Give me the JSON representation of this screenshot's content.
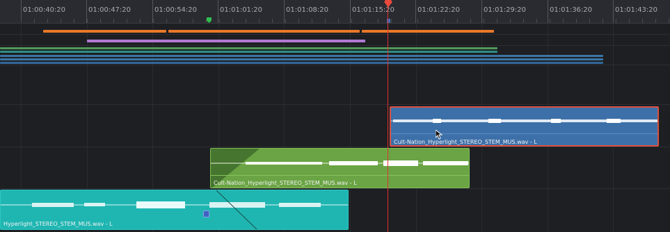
{
  "app": "DaVinci Resolve Fairlight timeline",
  "timecodes": [
    "01:00:40:20",
    "01:00:47:20",
    "01:00:54:20",
    "01:01:01:20",
    "01:01:08:20",
    "01:01:15:20",
    "01:01:22:20",
    "01:01:29:20",
    "01:01:36:20",
    "01:01:43:20"
  ],
  "colors": {
    "orange": "#e8782a",
    "purple": "#b07ad1",
    "green_line": "#4f9a5b",
    "teal_line": "#2f8f86",
    "blue_line": "#3a75a6",
    "clip_blue": "#3d70a9",
    "clip_green": "#6aa444",
    "clip_teal": "#1fb6b2",
    "playhead": "#e0332f"
  },
  "clips": {
    "blue": {
      "label": "Cult-Nation_Hyperlight_STEREO_STEM_MUS.wav - L"
    },
    "green": {
      "label": "Cult-Nation_Hyperlight_STEREO_STEM_MUS.wav - L"
    },
    "teal": {
      "label": "Hyperlight_STEREO_STEM_MUS.wav - L"
    }
  },
  "icons": [
    "playhead-icon",
    "marker-icon",
    "clip-marker-icon",
    "mouse-cursor-icon"
  ]
}
